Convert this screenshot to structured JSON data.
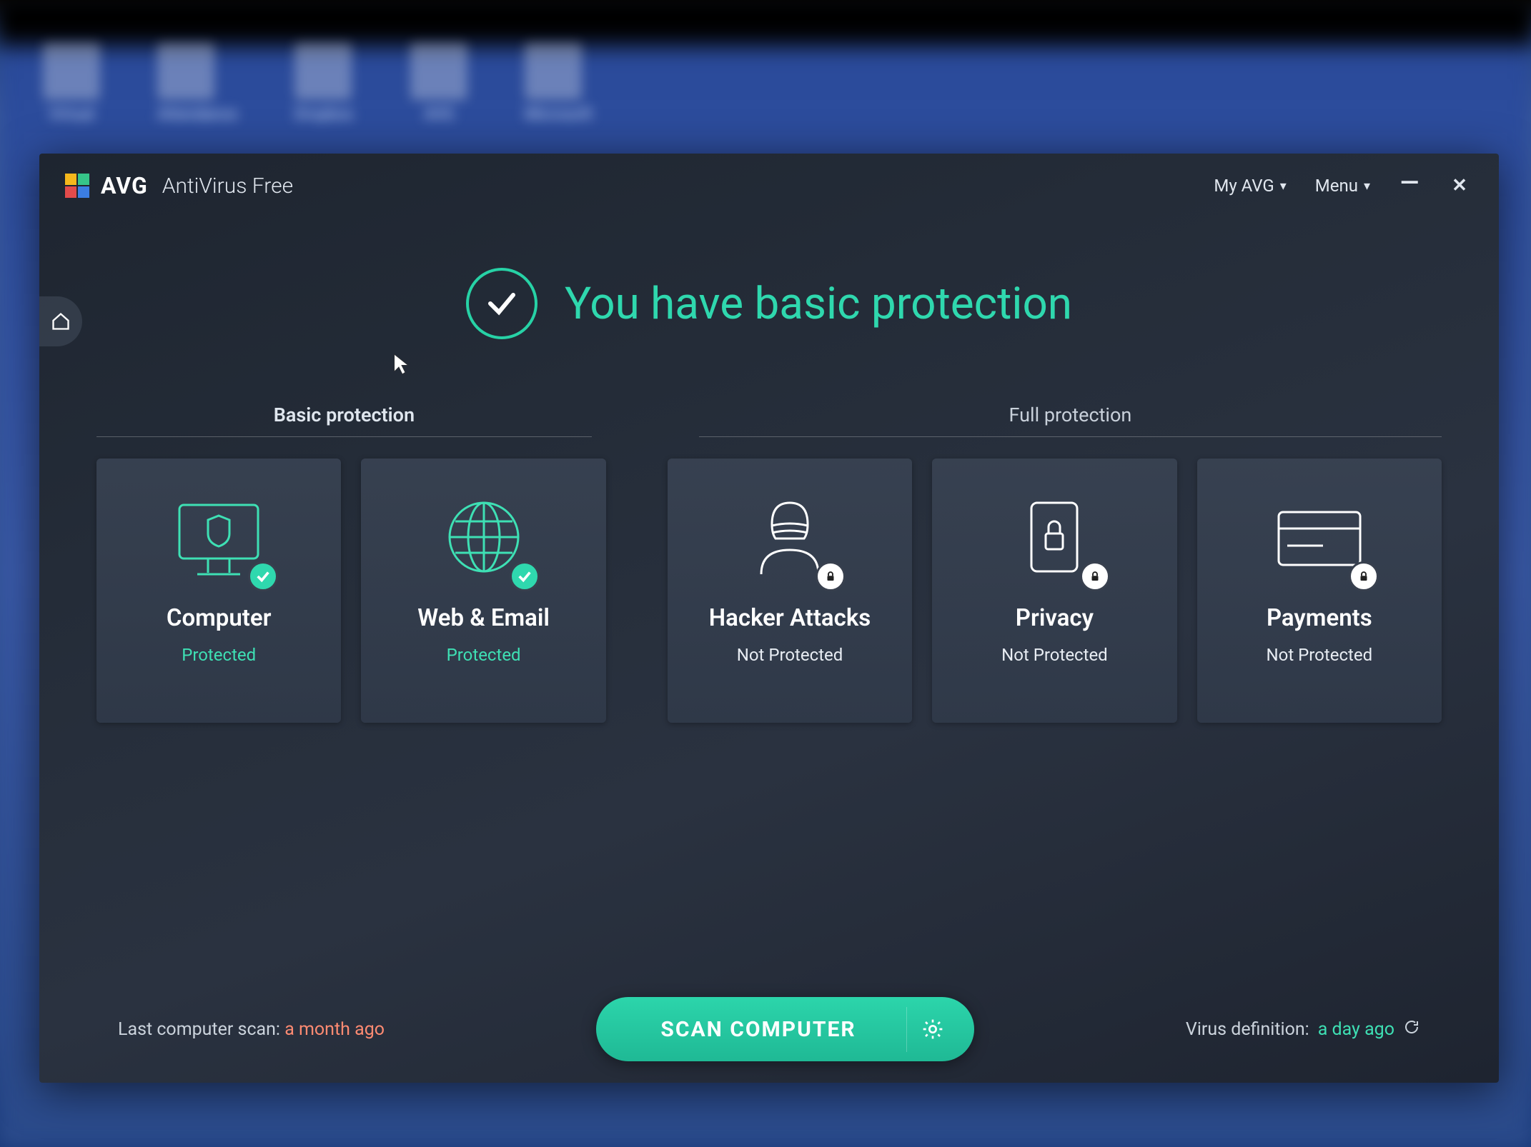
{
  "desktop": {
    "icons": [
      "Virtual",
      "Attendance",
      "Dropbox",
      "AVG",
      "Microsoft"
    ]
  },
  "window": {
    "brand": "AVG",
    "product": "AntiVirus Free",
    "my_avg": "My AVG",
    "menu": "Menu"
  },
  "status": {
    "headline": "You have basic protection"
  },
  "sections": {
    "basic": "Basic protection",
    "full": "Full protection"
  },
  "tiles": [
    {
      "title": "Computer",
      "status": "Protected",
      "state": "ok"
    },
    {
      "title": "Web & Email",
      "status": "Protected",
      "state": "ok"
    },
    {
      "title": "Hacker Attacks",
      "status": "Not Protected",
      "state": "lock"
    },
    {
      "title": "Privacy",
      "status": "Not Protected",
      "state": "lock"
    },
    {
      "title": "Payments",
      "status": "Not Protected",
      "state": "lock"
    }
  ],
  "footer": {
    "last_scan_label": "Last computer scan:",
    "last_scan_value": "a month ago",
    "scan_button": "SCAN COMPUTER",
    "vdef_label": "Virus definition:",
    "vdef_value": "a day ago"
  }
}
